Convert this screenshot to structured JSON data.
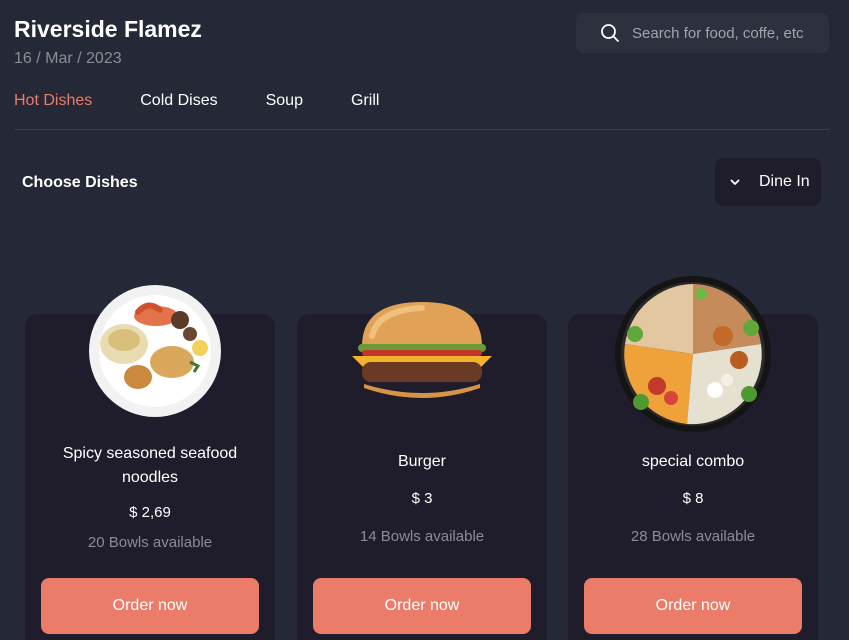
{
  "header": {
    "title": "Riverside Flamez",
    "date": "16 / Mar / 2023"
  },
  "search": {
    "placeholder": "Search for food, coffe, etc",
    "icon": "search-icon"
  },
  "tabs": [
    {
      "label": "Hot Dishes",
      "active": true
    },
    {
      "label": "Cold Dises",
      "active": false
    },
    {
      "label": "Soup",
      "active": false
    },
    {
      "label": "Grill",
      "active": false
    }
  ],
  "section": {
    "title": "Choose Dishes",
    "dine_option": "Dine In",
    "dine_icon": "chevron-down-icon"
  },
  "dishes": [
    {
      "name": "Spicy seasoned seafood noodles",
      "price": "$ 2,69",
      "availability": "20 Bowls available",
      "button": "Order now"
    },
    {
      "name": "Burger",
      "price": "$ 3",
      "availability": "14 Bowls available",
      "button": "Order now"
    },
    {
      "name": "special combo",
      "price": "$ 8",
      "availability": "28 Bowls available",
      "button": "Order now"
    }
  ],
  "colors": {
    "background": "#252836",
    "card": "#1f1d2b",
    "accent": "#ea7c69",
    "muted": "#8b8c97"
  }
}
